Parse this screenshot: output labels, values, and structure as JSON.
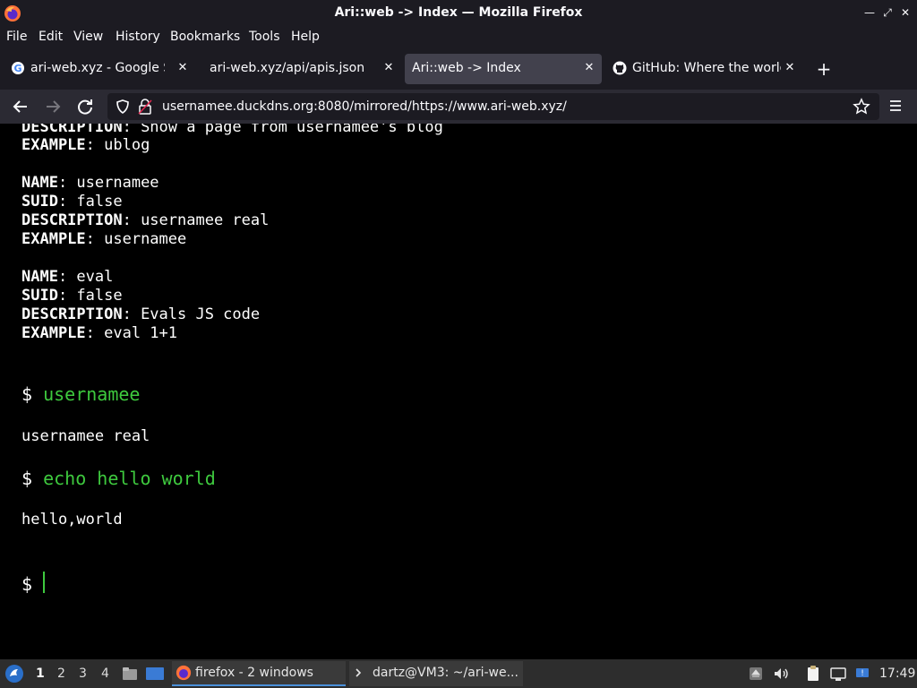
{
  "window": {
    "title": "Ari::web -> Index — Mozilla Firefox"
  },
  "menu": {
    "file": "File",
    "edit": "Edit",
    "view": "View",
    "history": "History",
    "bookmarks": "Bookmarks",
    "tools": "Tools",
    "help": "Help"
  },
  "tabs": [
    {
      "title": "ari-web.xyz - Google Sea",
      "icon": "google-icon"
    },
    {
      "title": "ari-web.xyz/api/apis.json",
      "icon": "none"
    },
    {
      "title": "Ari::web -> Index",
      "icon": "none",
      "active": true
    },
    {
      "title": "GitHub: Where the world",
      "icon": "github-icon"
    }
  ],
  "navbar": {
    "url": "usernamee.duckdns.org:8080/mirrored/https://www.ari-web.xyz/"
  },
  "terminal": {
    "partial_line_key": "DESCRIPTION",
    "partial_line_value": ": Show a page from usernamee's blog",
    "blocks": [
      {
        "key": "EXAMPLE",
        "value": ": ublog"
      },
      {
        "key": "NAME",
        "value": ": usernamee"
      },
      {
        "key": "SUID",
        "value": ": false"
      },
      {
        "key": "DESCRIPTION",
        "value": ": usernamee real"
      },
      {
        "key": "EXAMPLE",
        "value": ": usernamee"
      },
      {
        "key": "NAME",
        "value": ": eval"
      },
      {
        "key": "SUID",
        "value": ": false"
      },
      {
        "key": "DESCRIPTION",
        "value": ": Evals JS code"
      },
      {
        "key": "EXAMPLE",
        "value": ": eval 1+1"
      }
    ],
    "prompt": "$",
    "commands": [
      {
        "cmd": "usernamee",
        "output": "usernamee real"
      },
      {
        "cmd": "echo hello world",
        "output": "hello,world"
      }
    ]
  },
  "taskbar": {
    "workspaces": [
      "1",
      "2",
      "3",
      "4"
    ],
    "apps": [
      {
        "label": "firefox - 2 windows"
      },
      {
        "label": "dartz@VM3: ~/ari-we..."
      }
    ],
    "clock": "17:49"
  },
  "colors": {
    "terminal_bg": "#000000",
    "command_green": "#3ec93e",
    "chrome_dark": "#1c1b22"
  }
}
